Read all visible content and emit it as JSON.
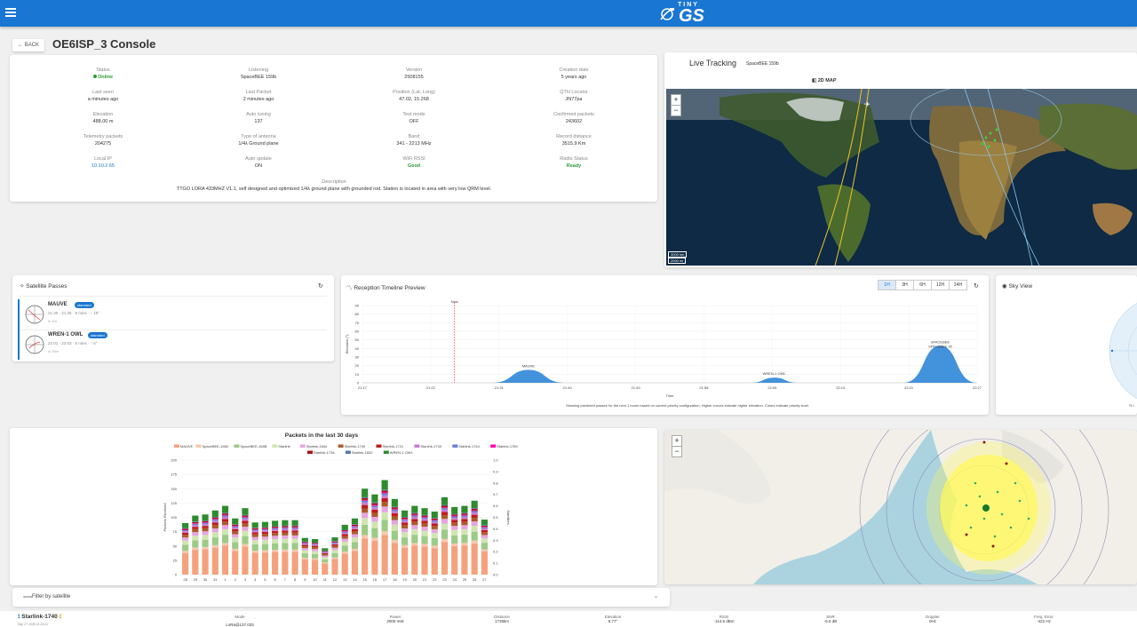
{
  "app": {
    "logo_small": "TINY",
    "logo_big": "GS"
  },
  "page": {
    "back_label": "← BACK",
    "title": "OE6ISP_3 Console"
  },
  "info": {
    "status": {
      "label": "Status",
      "value": "Online"
    },
    "listening": {
      "label": "Listening",
      "value": "SpaceBEE 159b"
    },
    "version": {
      "label": "Version",
      "value": "2508155"
    },
    "creation": {
      "label": "Creation date",
      "value": "5 years ago"
    },
    "last_seen": {
      "label": "Last seen",
      "value": "a minutes ago"
    },
    "last_packet": {
      "label": "Last Packet",
      "value": "2 minutes ago"
    },
    "position": {
      "label": "Position (Lat, Long)",
      "value": "47.02, 15.268"
    },
    "qth": {
      "label": "QTH Locator",
      "value": "JN77pa"
    },
    "elevation": {
      "label": "Elevation",
      "value": "488.00 m"
    },
    "auto_tuning": {
      "label": "Auto tuning",
      "value": "137"
    },
    "test_mode": {
      "label": "Test mode",
      "value": "OFF"
    },
    "confirmed": {
      "label": "Confirmed packets",
      "value": "243602"
    },
    "telemetry": {
      "label": "Telemetry packets",
      "value": "204275"
    },
    "antenna": {
      "label": "Type of antenna",
      "value": "1/4λ Ground plane"
    },
    "band": {
      "label": "Band",
      "value": "341 - 2213 MHz"
    },
    "record": {
      "label": "Record distance",
      "value": "3515.9 Km"
    },
    "local_ip": {
      "label": "Local IP",
      "value": "10.10.2.65"
    },
    "auto_update": {
      "label": "Auto update",
      "value": "ON"
    },
    "wifi": {
      "label": "WiFi RSSI",
      "value": "Good"
    },
    "radio": {
      "label": "Radio Status",
      "value": "Ready"
    },
    "description": {
      "label": "Description",
      "value": "TTGO LORA 433MHZ V1.1, self designed and optimized 1/4λ ground plane with grounded rod. Station is located in area with very low QRM level."
    }
  },
  "live": {
    "title": "Live Tracking",
    "sat": "SpaceBEE 159b",
    "map_tab": "2D MAP",
    "scale_a": "3000 km",
    "scale_b": "2000 mi"
  },
  "passes": {
    "title": "Satellite Passes",
    "items": [
      {
        "name": "MAUVE",
        "tag": "standard",
        "time": "21:30 - 21:36 · 8 mins · ↑ 15°",
        "sub": "in 3m"
      },
      {
        "name": "WREN-1 OWL",
        "tag": "standard",
        "time": "22:01 - 22:03 · 5 mins · ↑ 6°",
        "sub": "in 35m"
      }
    ]
  },
  "timeline": {
    "title": "Reception Timeline Preview",
    "ranges": [
      "1H",
      "3H",
      "6H",
      "12H",
      "24H"
    ],
    "now_label": "Now",
    "xlabel": "Time",
    "ylabel": "Elevation (°)",
    "footer": "Showing predicted passes for the next 1 hours based on current priority configuration. Higher curves indicate higher elevation. Colors indicate priority level.",
    "chart_data": {
      "type": "area",
      "x_ticks": [
        "21:17",
        "21:22",
        "21:31",
        "21:40",
        "21:49",
        "21:58",
        "22:05",
        "22:13",
        "22:21",
        "22:27"
      ],
      "y_ticks": [
        0,
        10,
        20,
        30,
        40,
        50,
        60,
        70,
        80,
        90
      ],
      "ylim": [
        0,
        90
      ],
      "passes": [
        {
          "label": "MAUVE",
          "start": 0.21,
          "end": 0.33,
          "peak": 15
        },
        {
          "label": "WREN-1 OWL",
          "start": 0.63,
          "end": 0.71,
          "peak": 6
        },
        {
          "label": "SPACEBEE",
          "label2": "SPACEBEE 90",
          "start": 0.88,
          "end": 1.0,
          "peak": 43
        }
      ]
    }
  },
  "sky": {
    "title": "Sky View",
    "note": "No"
  },
  "packets": {
    "title": "Packets in the last 30 days",
    "chart_data": {
      "type": "bar",
      "stacked": true,
      "ylabel": "Packets Received",
      "y2label": "Satellites",
      "categories": [
        "28",
        "29",
        "30",
        "31",
        "1",
        "2",
        "3",
        "4",
        "5",
        "6",
        "7",
        "8",
        "9",
        "10",
        "11",
        "12",
        "13",
        "14",
        "15",
        "16",
        "17",
        "18",
        "19",
        "20",
        "21",
        "22",
        "23",
        "24",
        "25",
        "26",
        "27"
      ],
      "ylim": [
        0,
        200
      ],
      "legend": [
        "MAUVE",
        "SpaceBEE-158C",
        "SpaceBEE-158B",
        "Starlink",
        "Starlink-1634",
        "Starlink-1740",
        "Starlink-1721",
        "Starlink-1733",
        "Starlink-1744",
        "Starlink-1750",
        "Starlink-1734",
        "Starlink-1832",
        "WREN-1 OWL"
      ],
      "series_colors": [
        "#f4a27d",
        "#f7c7b0",
        "#9ccb86",
        "#cfe6b0",
        "#e7a4e0",
        "#a95c2a",
        "#c01b1b",
        "#c77cd6",
        "#6b7fd1",
        "#f0a",
        "#a11",
        "#57a",
        "#2e8b2e"
      ],
      "totals": [
        90,
        103,
        105,
        112,
        120,
        98,
        116,
        91,
        92,
        94,
        95,
        95,
        64,
        62,
        46,
        65,
        87,
        98,
        150,
        140,
        165,
        132,
        112,
        120,
        116,
        110,
        135,
        118,
        120,
        129,
        96
      ]
    }
  },
  "filter": {
    "label": "Filter by satellite"
  },
  "bottom": {
    "sat": "Starlink-1740",
    "date": "Sep 27 2025 21:15:12",
    "mode_l": "Mode",
    "mode_v": "LoRa@137.033",
    "power_l": "Power",
    "power_v": "2000 mW",
    "dist_l": "Distance",
    "dist_v": "1735km",
    "elev_l": "Elevation",
    "elev_v": "8.77°",
    "rssi_l": "RSSI",
    "rssi_v": "-114.5 dBm",
    "snr_l": "SNR",
    "snr_v": "-5.5 dB",
    "dopp_l": "Doppler",
    "dopp_v": "0Hz",
    "freq_l": "Freq. Error",
    "freq_v": "-422 Hz"
  }
}
